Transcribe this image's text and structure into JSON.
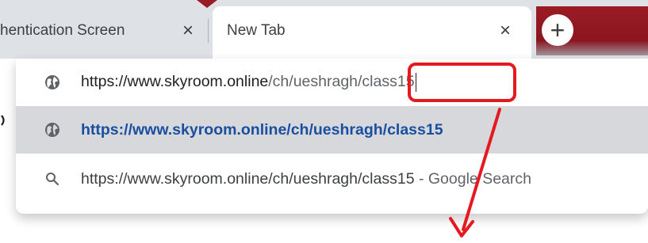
{
  "tabs": [
    {
      "title": "hentication Screen",
      "close": "×",
      "active": false
    },
    {
      "title": "New Tab",
      "close": "×",
      "active": true
    }
  ],
  "new_tab_button": "+",
  "omnibox": {
    "input": {
      "host": "https://www.skyroom.online",
      "path": "/ch/ueshragh/class15",
      "icon": "globe-icon"
    },
    "suggestion": {
      "text": "https://www.skyroom.online/ch/ueshragh/class15",
      "icon": "globe-icon"
    },
    "search": {
      "query": "https://www.skyroom.online/ch/ueshragh/class15",
      "separator": "-",
      "engine": "Google Search",
      "icon": "search-icon"
    }
  },
  "colors": {
    "annotation": "#e51920",
    "tab_accent": "#9b1b25",
    "selected_row": "#d7d8db",
    "link": "#1a4fa0"
  }
}
